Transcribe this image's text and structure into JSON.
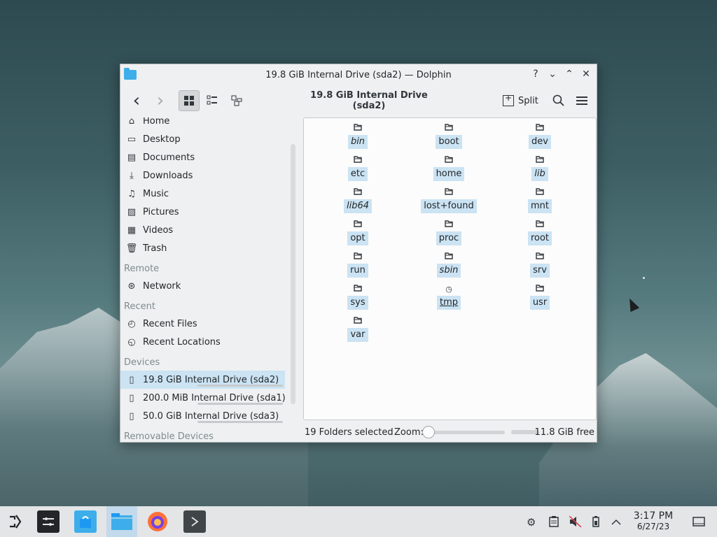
{
  "window": {
    "title": "19.8 GiB Internal Drive (sda2) — Dolphin",
    "help_label": "?",
    "minimize_label": "⌄",
    "maximize_label": "⌃",
    "close_label": "✕"
  },
  "toolbar": {
    "back_label": "‹",
    "forward_label": "›",
    "path_title": "19.8 GiB Internal Drive (sda2)",
    "split_label": "Split"
  },
  "sidebar": {
    "places": [
      {
        "label": "Home",
        "icon": "home-icon",
        "glyph": "⌂"
      },
      {
        "label": "Desktop",
        "icon": "desktop-icon",
        "glyph": "▭"
      },
      {
        "label": "Documents",
        "icon": "documents-icon",
        "glyph": "▤"
      },
      {
        "label": "Downloads",
        "icon": "downloads-icon",
        "glyph": "⤓"
      },
      {
        "label": "Music",
        "icon": "music-icon",
        "glyph": "♫"
      },
      {
        "label": "Pictures",
        "icon": "pictures-icon",
        "glyph": "▨"
      },
      {
        "label": "Videos",
        "icon": "videos-icon",
        "glyph": "▦"
      },
      {
        "label": "Trash",
        "icon": "trash-icon",
        "glyph": "🗑"
      }
    ],
    "remote_heading": "Remote",
    "remote": [
      {
        "label": "Network",
        "icon": "network-icon",
        "glyph": "⊛"
      }
    ],
    "recent_heading": "Recent",
    "recent": [
      {
        "label": "Recent Files",
        "icon": "recent-files-icon",
        "glyph": "◴"
      },
      {
        "label": "Recent Locations",
        "icon": "recent-locations-icon",
        "glyph": "◵"
      }
    ],
    "devices_heading": "Devices",
    "devices": [
      {
        "label": "19.8 GiB Internal Drive (sda2)",
        "icon": "drive-icon",
        "glyph": "▯",
        "selected": true
      },
      {
        "label": "200.0 MiB Internal Drive (sda1)",
        "icon": "drive-icon",
        "glyph": "▯",
        "selected": false
      },
      {
        "label": "50.0 GiB Internal Drive (sda3)",
        "icon": "drive-icon",
        "glyph": "▯",
        "selected": false
      }
    ],
    "removable_heading": "Removable Devices"
  },
  "folders": [
    {
      "name": "bin",
      "style": "italic"
    },
    {
      "name": "boot",
      "style": "normal"
    },
    {
      "name": "dev",
      "style": "normal"
    },
    {
      "name": "etc",
      "style": "normal"
    },
    {
      "name": "home",
      "style": "normal"
    },
    {
      "name": "lib",
      "style": "italic"
    },
    {
      "name": "lib64",
      "style": "italic"
    },
    {
      "name": "lost+found",
      "style": "normal"
    },
    {
      "name": "mnt",
      "style": "normal"
    },
    {
      "name": "opt",
      "style": "normal"
    },
    {
      "name": "proc",
      "style": "normal"
    },
    {
      "name": "root",
      "style": "normal"
    },
    {
      "name": "run",
      "style": "normal"
    },
    {
      "name": "sbin",
      "style": "italic"
    },
    {
      "name": "srv",
      "style": "normal"
    },
    {
      "name": "sys",
      "style": "normal"
    },
    {
      "name": "tmp",
      "style": "underline"
    },
    {
      "name": "usr",
      "style": "normal"
    },
    {
      "name": "var",
      "style": "normal"
    }
  ],
  "statusbar": {
    "selection": "19 Folders selected",
    "zoom_label": "Zoom:",
    "free_space": "11.8 GiB free"
  },
  "taskbar": {
    "time": "3:17 PM",
    "date": "6/27/23"
  },
  "colors": {
    "selection": "#cbe3f3",
    "accent": "#3daee9"
  }
}
